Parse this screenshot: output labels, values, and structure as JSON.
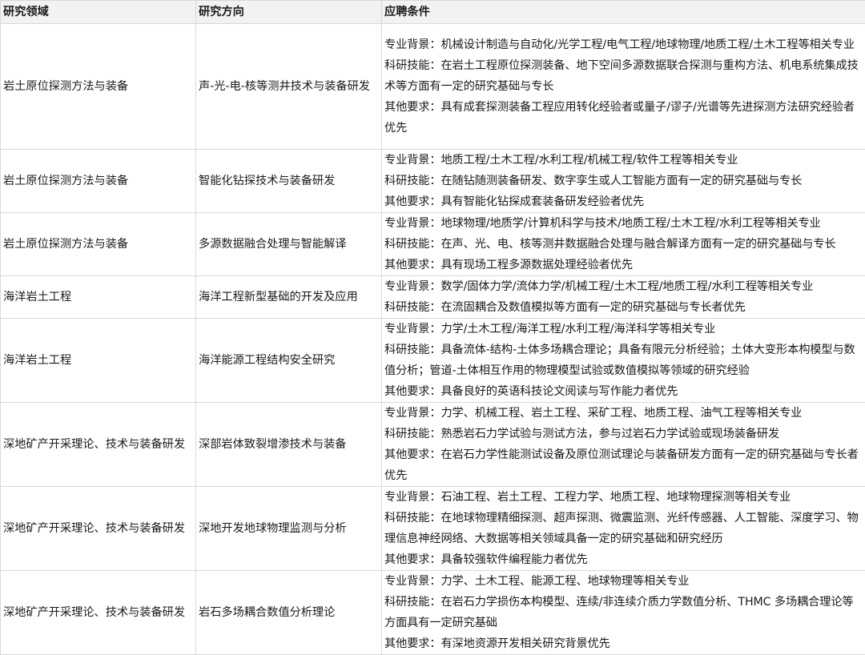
{
  "headers": {
    "field": "研究领域",
    "direction": "研究方向",
    "requirements": "应聘条件"
  },
  "rows": [
    {
      "field": "岩土原位探测方法与装备",
      "direction": "声-光-电-核等测井技术与装备研发",
      "requirements": [
        "专业背景：机械设计制造与自动化/光学工程/电气工程/地球物理/地质工程/土木工程等相关专业",
        "科研技能：在岩土工程原位探测装备、地下空间多源数据联合探测与重构方法、机电系统集成技术等方面有一定的研究基础与专长",
        "其他要求：具有成套探测装备工程应用转化经验者或量子/谬子/光谱等先进探测方法研究经验者优先"
      ]
    },
    {
      "field": "岩土原位探测方法与装备",
      "direction": "智能化钻探技术与装备研发",
      "requirements": [
        "专业背景：地质工程/土木工程/水利工程/机械工程/软件工程等相关专业",
        "科研技能：在随钻随测装备研发、数字孪生或人工智能方面有一定的研究基础与专长",
        "其他要求：具有智能化钻探成套装备研发经验者优先"
      ]
    },
    {
      "field": "岩土原位探测方法与装备",
      "direction": "多源数据融合处理与智能解译",
      "requirements": [
        "专业背景：地球物理/地质学/计算机科学与技术/地质工程/土木工程/水利工程等相关专业",
        "科研技能：在声、光、电、核等测井数据融合处理与融合解译方面有一定的研究基础与专长",
        "其他要求：具有现场工程多源数据处理经验者优先"
      ]
    },
    {
      "field": "海洋岩土工程",
      "direction": "海洋工程新型基础的开发及应用",
      "requirements": [
        "专业背景：数学/固体力学/流体力学/机械工程/土木工程/地质工程/水利工程等相关专业",
        "科研技能：在流固耦合及数值模拟等方面有一定的研究基础与专长者优先"
      ]
    },
    {
      "field": "海洋岩土工程",
      "direction": "海洋能源工程结构安全研究",
      "requirements": [
        "专业背景：力学/土木工程/海洋工程/水利工程/海洋科学等相关专业",
        "科研技能：具备流体-结构-土体多场耦合理论；具备有限元分析经验；土体大变形本构模型与数值分析；管道-土体相互作用的物理模型试验或数值模拟等领域的研究经验",
        "其他要求：具备良好的英语科技论文阅读与写作能力者优先"
      ]
    },
    {
      "field": "深地矿产开采理论、技术与装备研发",
      "direction": "深部岩体致裂增渗技术与装备",
      "requirements": [
        "专业背景：力学、机械工程、岩土工程、采矿工程、地质工程、油气工程等相关专业",
        "科研技能：熟悉岩石力学试验与测试方法，参与过岩石力学试验或现场装备研发",
        "其他要求：在岩石力学性能测试设备及原位测试理论与装备研发方面有一定的研究基础与专长者优先"
      ]
    },
    {
      "field": "深地矿产开采理论、技术与装备研发",
      "direction": "深地开发地球物理监测与分析",
      "requirements": [
        "专业背景：石油工程、岩土工程、工程力学、地质工程、地球物理探测等相关专业",
        "科研技能：在地球物理精细探测、超声探测、微震监测、光纤传感器、人工智能、深度学习、物理信息神经网络、大数据等相关领域具备一定的研究基础和研究经历",
        "其他要求：具备较强软件编程能力者优先"
      ]
    },
    {
      "field": "深地矿产开采理论、技术与装备研发",
      "direction": "岩石多场耦合数值分析理论",
      "requirements": [
        "专业背景：力学、土木工程、能源工程、地球物理等相关专业",
        "科研技能：在岩石力学损伤本构模型、连续/非连续介质力学数值分析、THMC 多场耦合理论等方面具有一定研究基础",
        "其他要求：有深地资源开发相关研究背景优先"
      ]
    }
  ]
}
